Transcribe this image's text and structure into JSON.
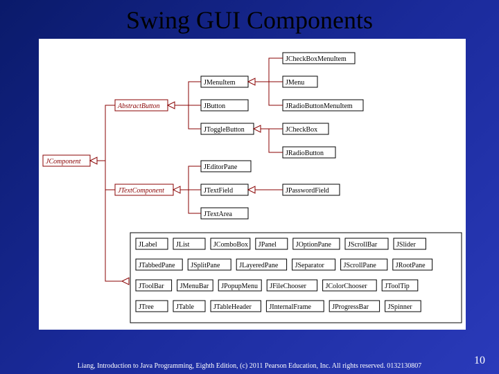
{
  "title": "Swing GUI Components",
  "footer": "Liang, Introduction to Java Programming, Eighth Edition, (c) 2011 Pearson Education, Inc. All rights reserved. 0132130807",
  "pageNumber": "10",
  "hierarchy": {
    "root": "JComponent",
    "abstractButton": {
      "name": "AbstractButton",
      "children": {
        "JMenuItem": [
          "JCheckBoxMenuItem",
          "JMenu",
          "JRadioButtonMenuItem"
        ],
        "JButton": [],
        "JToggleButton": [
          "JCheckBox",
          "JRadioButton"
        ]
      }
    },
    "textComponent": {
      "name": "JTextComponent",
      "children": {
        "JEditorPane": [],
        "JTextField": [
          "JPasswordField"
        ],
        "JTextArea": []
      }
    },
    "flat": [
      [
        "JLabel",
        "JList",
        "JComboBox",
        "JPanel",
        "JOptionPane",
        "JScrollBar",
        "JSlider"
      ],
      [
        "JTabbedPane",
        "JSplitPane",
        "JLayeredPane",
        "JSeparator",
        "JScrollPane",
        "JRootPane"
      ],
      [
        "JToolBar",
        "JMenuBar",
        "JPopupMenu",
        "JFileChooser",
        "JColorChooser",
        "JToolTip"
      ],
      [
        "JTree",
        "JTable",
        "JTableHeader",
        "JInternalFrame",
        "JProgressBar",
        "JSpinner"
      ]
    ]
  }
}
